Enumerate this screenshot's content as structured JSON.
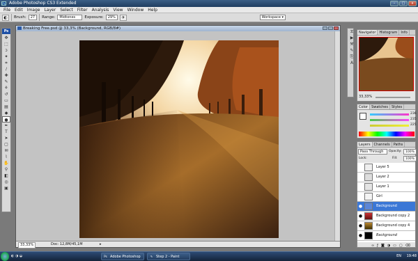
{
  "window": {
    "title": "Adobe Photoshop CS3 Extended",
    "ps_label": "Ps"
  },
  "menu": [
    "File",
    "Edit",
    "Image",
    "Layer",
    "Select",
    "Filter",
    "Analysis",
    "View",
    "Window",
    "Help"
  ],
  "options": {
    "brush_label": "Brush:",
    "brush_size": "27",
    "range_label": "Range:",
    "range_value": "Midtones",
    "exposure_label": "Exposure:",
    "exposure_value": "29%",
    "workspace_label": "Workspace ▾"
  },
  "document": {
    "title": "Breaking Free.psd @ 33,3% (Background, RGB/8#)",
    "zoom": "33,33%",
    "doc_size": "Doc: 12,8M/45,1M"
  },
  "navigator": {
    "tabs": [
      "Navigator",
      "Histogram",
      "Info"
    ],
    "zoom": "33,33%"
  },
  "color": {
    "tabs": [
      "Color",
      "Swatches",
      "Styles"
    ],
    "values": [
      "236",
      "235",
      "225"
    ],
    "colors": {
      "r": "#ef3d3d",
      "g": "#e23de6",
      "b": "#d6d63a"
    }
  },
  "layers": {
    "tabs": [
      "Layers",
      "Channels",
      "Paths"
    ],
    "blend_mode": "Pass Through",
    "opacity_label": "Opacity:",
    "opacity_value": "100%",
    "lock_label": "Lock:",
    "fill_label": "Fill:",
    "fill_value": "100%",
    "items": [
      {
        "name": "Layer 5",
        "visible": false
      },
      {
        "name": "Layer 2",
        "visible": false
      },
      {
        "name": "Layer 1",
        "visible": false
      },
      {
        "name": "Girl",
        "visible": false
      },
      {
        "name": "Background",
        "visible": true,
        "selected": true
      },
      {
        "name": "Background copy 2",
        "visible": true
      },
      {
        "name": "Background copy 4",
        "visible": true
      },
      {
        "name": "Background",
        "visible": true
      }
    ]
  },
  "taskbar": {
    "items": [
      "Adobe Photoshop C...",
      "Step 2 - Paint"
    ],
    "lang": "EN",
    "time": "19:48"
  }
}
